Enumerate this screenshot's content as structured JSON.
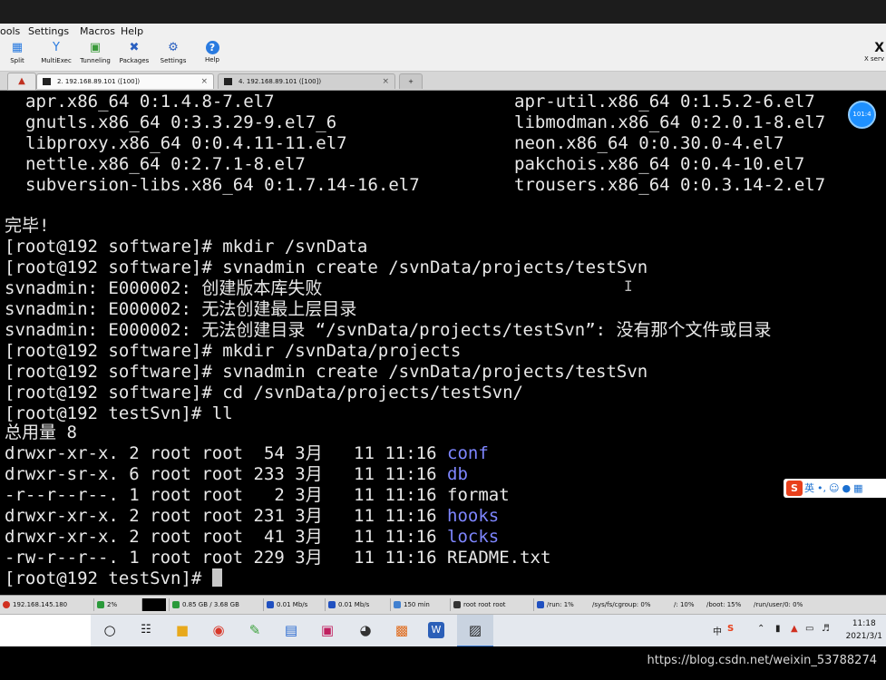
{
  "menu": {
    "items": [
      "ools",
      "Settings",
      "Macros",
      "Help"
    ]
  },
  "toolbar": {
    "buttons": [
      {
        "label": "Split",
        "icon": "split-icon"
      },
      {
        "label": "MultiExec",
        "icon": "multiexec-icon"
      },
      {
        "label": "Tunneling",
        "icon": "tunneling-icon"
      },
      {
        "label": "Packages",
        "icon": "packages-icon"
      },
      {
        "label": "Settings",
        "icon": "settings-icon"
      },
      {
        "label": "Help",
        "icon": "help-icon"
      }
    ],
    "xserver_label": "X serv"
  },
  "tabs": [
    {
      "label": "2. 192.168.89.101 ([100])"
    },
    {
      "label": "4. 192.168.89.101 ([100])"
    }
  ],
  "terminal": {
    "pkg_left": [
      "apr.x86_64 0:1.4.8-7.el7",
      "gnutls.x86_64 0:3.3.29-9.el7_6",
      "libproxy.x86_64 0:0.4.11-11.el7",
      "nettle.x86_64 0:2.7.1-8.el7",
      "subversion-libs.x86_64 0:1.7.14-16.el7"
    ],
    "pkg_right": [
      "apr-util.x86_64 0:1.5.2-6.el7",
      "libmodman.x86_64 0:2.0.1-8.el7",
      "neon.x86_64 0:0.30.0-4.el7",
      "pakchois.x86_64 0:0.4-10.el7",
      "trousers.x86_64 0:0.3.14-2.el7"
    ],
    "lines": [
      "完毕!",
      "[root@192 software]# mkdir /svnData",
      "[root@192 software]# svnadmin create /svnData/projects/testSvn",
      "svnadmin: E000002: 创建版本库失败",
      "svnadmin: E000002: 无法创建最上层目录",
      "svnadmin: E000002: 无法创建目录 “/svnData/projects/testSvn”: 没有那个文件或目录",
      "[root@192 software]# mkdir /svnData/projects",
      "[root@192 software]# svnadmin create /svnData/projects/testSvn",
      "[root@192 software]# cd /svnData/projects/testSvn/",
      "[root@192 testSvn]# ll",
      "总用量 8"
    ],
    "listing": [
      {
        "prefix": "drwxr-xr-x. 2 root root  54 3月   11 11:16 ",
        "name": "conf",
        "dir": true
      },
      {
        "prefix": "drwxr-sr-x. 6 root root 233 3月   11 11:16 ",
        "name": "db",
        "dir": true
      },
      {
        "prefix": "-r--r--r--. 1 root root   2 3月   11 11:16 ",
        "name": "format",
        "dir": false
      },
      {
        "prefix": "drwxr-xr-x. 2 root root 231 3月   11 11:16 ",
        "name": "hooks",
        "dir": true
      },
      {
        "prefix": "drwxr-xr-x. 2 root root  41 3月   11 11:16 ",
        "name": "locks",
        "dir": true
      },
      {
        "prefix": "-rw-r--r--. 1 root root 229 3月   11 11:16 ",
        "name": "README.txt",
        "dir": false
      }
    ],
    "prompt": "[root@192 testSvn]# "
  },
  "bubble_text": "101:4",
  "ime": {
    "badge": "S",
    "label": "英"
  },
  "status": [
    {
      "text": "192.168.145.180",
      "color": "#d03020"
    },
    {
      "text": "2%",
      "color": "#2a9a3a"
    },
    {
      "text": "",
      "color": "#000000"
    },
    {
      "text": "0.85 GB / 3.68 GB",
      "color": "#2a9a3a"
    },
    {
      "text": "0.01 Mb/s",
      "color": "#2050c0"
    },
    {
      "text": "0.01 Mb/s",
      "color": "#2050c0"
    },
    {
      "text": "150 min",
      "color": "#4080d0"
    },
    {
      "text": "root root root",
      "color": "#333333"
    },
    {
      "text": "/run: 1%",
      "color": "#2050c0"
    },
    {
      "text": "/sys/fs/cgroup: 0%",
      "color": "#2050c0"
    },
    {
      "text": "/: 10%",
      "color": "#2050c0"
    },
    {
      "text": "/boot: 15%",
      "color": "#2050c0"
    },
    {
      "text": "/run/user/0: 0%",
      "color": "#2050c0"
    }
  ],
  "taskbar": {
    "apps": [
      "search-circle-icon",
      "task-view-icon",
      "file-explorer-icon",
      "chrome-icon",
      "notepad-plus-icon",
      "remote-desktop-icon",
      "app-icon",
      "browser-icon",
      "office-icon",
      "word-icon",
      "mobaxterm-icon"
    ],
    "tray": {
      "lang": "中",
      "time": "11:18",
      "date": "2021/3/1"
    }
  },
  "watermark": "https://blog.csdn.net/weixin_53788274"
}
